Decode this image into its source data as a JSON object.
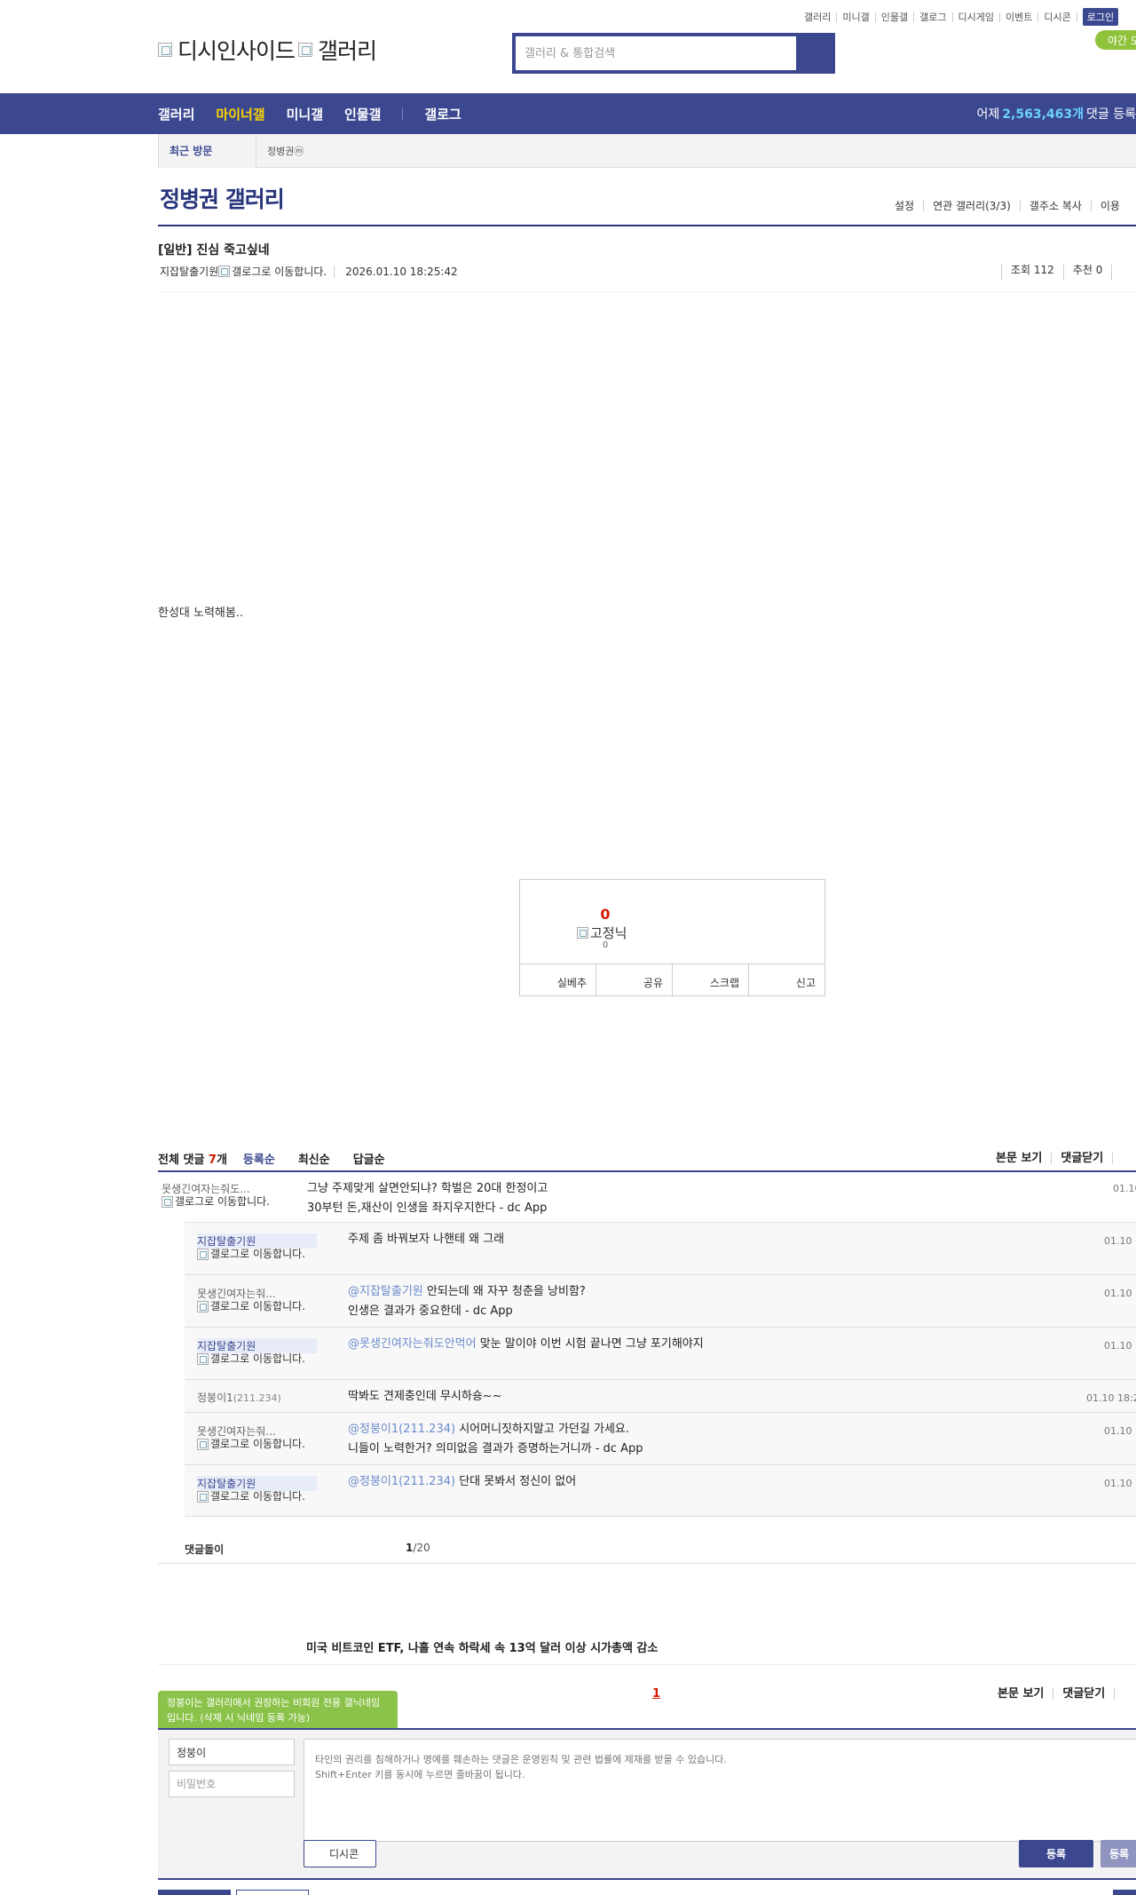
{
  "util_links": [
    "갤러리",
    "미니갤",
    "인물갤",
    "갤로그",
    "디시게임",
    "이벤트",
    "디시콘"
  ],
  "login_label": "로그인",
  "night_mode_label": "야간 모",
  "logo": {
    "alt_main": "디시인사이드",
    "alt_sub": "갤러리"
  },
  "search": {
    "placeholder": "갤러리 & 통합검색"
  },
  "gnb": {
    "items": [
      "갤러리",
      "마이너갤",
      "미니갤",
      "인물갤"
    ],
    "gallog": "갤로그",
    "stat_prefix": "어제",
    "stat_num": "2,563,463개",
    "stat_suffix": "댓글 등록"
  },
  "recent": {
    "title": "최근 방문",
    "item": "정병권ⓜ"
  },
  "gallery": {
    "title": "정병권 갤러리",
    "tools": [
      "설정",
      "연관 갤러리(3/3)",
      "갤주소 복사",
      "이용"
    ]
  },
  "post": {
    "title": "[일반] 진심 죽고싶네",
    "writer": "지잡탈출기원",
    "writer_img_alt": "갤로그로 이동합니다.",
    "date": "2026.01.10 18:25:42",
    "views": "조회 112",
    "recommends": "추천 0",
    "body": "한성대 노력해봄.."
  },
  "recommend": {
    "count": "0",
    "fixnick_alt": "고정닉",
    "fixnick_count": "0",
    "actions": [
      "실베추",
      "공유",
      "스크랩",
      "신고"
    ]
  },
  "comments_header": {
    "total_label": "전체 댓글",
    "total_num": "7",
    "total_unit": "개",
    "sorts": [
      "등록순",
      "최신순",
      "답글순"
    ],
    "right": [
      "본문 보기",
      "댓글닫기"
    ]
  },
  "comments": {
    "main": {
      "nick": "못생긴여자는줘도...",
      "img_alt": "갤로그로 이동합니다.",
      "line1": "그냥 주제맞게 살면안되냐? 학벌은 20대 한정이고",
      "line2": "30부턴 돈,재산이 인생을 좌지우지한다 - dc App",
      "date": "01.10"
    },
    "replies": [
      {
        "nick": "지잡탈출기원",
        "img_alt": "갤로그로 이동합니다.",
        "mention": "",
        "text": "주제 좀 바꿔보자 나핸테 왜 그래",
        "line2": "",
        "date": "01.10 1"
      },
      {
        "nick": "못생긴여자는줘...",
        "img_alt": "갤로그로 이동합니다.",
        "mention": "@지잡탈출기원",
        "text": " 안되는데 왜 자꾸 청춘을 낭비함?",
        "line2": "인생은 결과가 중요한데 - dc App",
        "date": "01.10 1"
      },
      {
        "nick": "지잡탈출기원",
        "img_alt": "갤로그로 이동합니다.",
        "mention": "@못생긴여자는줘도안먹어",
        "text": " 맞눈 말이야 이번 시험 끝나면 그냥 포기해야지",
        "line2": "",
        "date": "01.10 1"
      },
      {
        "nick": "정붕이1",
        "ip": "(211.234)",
        "mention": "",
        "text": "딱봐도 견제충인데 무시하숑~~",
        "line2": "",
        "date": "01.10 18:2"
      },
      {
        "nick": "못생긴여자는줘...",
        "img_alt": "갤로그로 이동합니다.",
        "mention": "@정붕이1(211.234)",
        "text": " 시어머니짓하지말고 가던길 가세요.",
        "line2": "니들이 노력한거? 의미없음 결과가 증명하는거니까 - dc App",
        "date": "01.10 1"
      },
      {
        "nick": "지잡탈출기원",
        "img_alt": "갤로그로 이동합니다.",
        "mention": "@정붕이1(211.234)",
        "text": " 단대 못봐서 정신이 없어",
        "line2": "",
        "date": "01.10 1"
      }
    ]
  },
  "dolbot": {
    "label": "댓글돌이",
    "page_current": "1",
    "page_total": "/20"
  },
  "news": "미국 비트코인 ETF, 나흘 연속 하락세 속 13억 달러 이상 시가총액 감소",
  "write": {
    "tooltip": "정붕이는 갤러리에서 권장하는 비회원 전용 갤닉네임입니다. (삭제 시 닉네임 등록 가능)",
    "page": "1",
    "right": [
      "본문 보기",
      "댓글닫기"
    ],
    "nick_value": "정붕이",
    "pw_placeholder": "비밀번호",
    "textarea_placeholder": "타인의 권리를 침해하거나 명예를 훼손하는 댓글은 운영원칙 및 관련 법률에 제재를 받을 수 있습니다.\nShift+Enter 키를 동시에 누르면 줄바꿈이 됩니다.",
    "dccon": "디시콘",
    "submit": "등록",
    "submit2": "등록"
  },
  "colors": {
    "brand": "#3b4890",
    "accent_yellow": "#fdd400",
    "count_red": "#d31900",
    "tooltip_green": "#8bc34a"
  }
}
